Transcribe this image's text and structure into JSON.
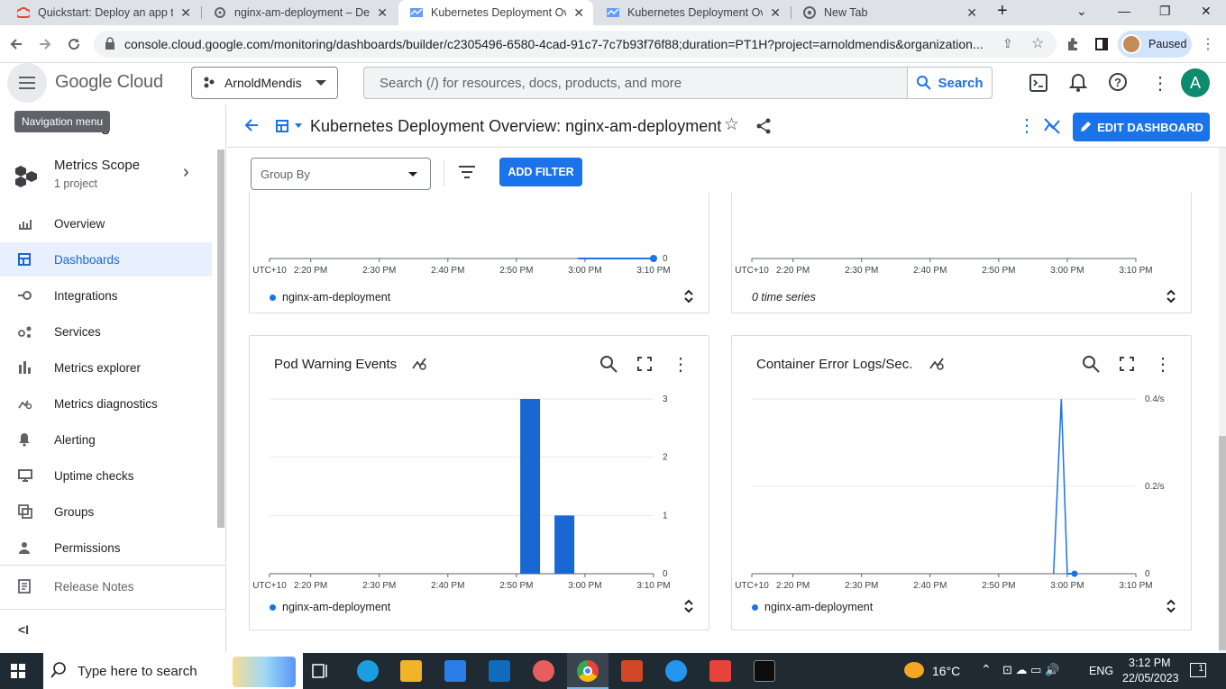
{
  "browser": {
    "tabs": [
      {
        "title": "Quickstart: Deploy an app to",
        "icon": "google-cloud-icon",
        "active": false
      },
      {
        "title": "nginx-am-deployment – Dep",
        "icon": "gear-icon",
        "active": false
      },
      {
        "title": "Kubernetes Deployment Ove",
        "icon": "monitoring-icon",
        "active": true
      },
      {
        "title": "Kubernetes Deployment Ove",
        "icon": "monitoring-icon",
        "active": false
      },
      {
        "title": "New Tab",
        "icon": "chrome-icon",
        "active": false
      }
    ],
    "url": "console.cloud.google.com/monitoring/dashboards/builder/c2305496-6580-4cad-91c7-7c7b93f76f88;duration=PT1H?project=arnoldmendis&organization...",
    "profile_status": "Paused"
  },
  "header": {
    "logo": "Google Cloud",
    "project": "ArnoldMendis",
    "search_placeholder": "Search (/) for resources, docs, products, and more",
    "search_button": "Search",
    "avatar_letter": "A"
  },
  "sidebar": {
    "tooltip": "Navigation menu",
    "section_title_fragment": "ing",
    "scope": {
      "title": "Metrics Scope",
      "subtitle": "1 project"
    },
    "items": [
      {
        "label": "Overview",
        "icon": "overview-icon",
        "active": false
      },
      {
        "label": "Dashboards",
        "icon": "dashboard-icon",
        "active": true
      },
      {
        "label": "Integrations",
        "icon": "integrations-icon",
        "active": false
      },
      {
        "label": "Services",
        "icon": "services-icon",
        "active": false
      },
      {
        "label": "Metrics explorer",
        "icon": "bar-chart-icon",
        "active": false
      },
      {
        "label": "Metrics diagnostics",
        "icon": "diagnostics-icon",
        "active": false
      },
      {
        "label": "Alerting",
        "icon": "bell-icon",
        "active": false
      },
      {
        "label": "Uptime checks",
        "icon": "monitor-icon",
        "active": false
      },
      {
        "label": "Groups",
        "icon": "groups-icon",
        "active": false
      },
      {
        "label": "Permissions",
        "icon": "person-icon",
        "active": false
      }
    ],
    "release_notes": "Release Notes"
  },
  "dashboard": {
    "title": "Kubernetes Deployment Overview: nginx-am-deployment",
    "edit_button": "EDIT DASHBOARD",
    "group_by": "Group By",
    "add_filter": "ADD FILTER"
  },
  "x_ticks": [
    "UTC+10",
    "2:20 PM",
    "2:30 PM",
    "2:40 PM",
    "2:50 PM",
    "3:00 PM",
    "3:10 PM"
  ],
  "charts": [
    {
      "id": "top-left",
      "legend": "nginx-am-deployment",
      "y_label": "0"
    },
    {
      "id": "top-right",
      "legend": "0 time series"
    },
    {
      "id": "pod-warning",
      "title": "Pod Warning Events",
      "legend": "nginx-am-deployment",
      "y_ticks": [
        "3",
        "2",
        "1",
        "0"
      ]
    },
    {
      "id": "container-error",
      "title": "Container Error Logs/Sec.",
      "legend": "nginx-am-deployment",
      "y_ticks": [
        "0.4/s",
        "0.2/s",
        "0"
      ]
    }
  ],
  "chart_data": [
    {
      "type": "line",
      "series": [
        {
          "name": "nginx-am-deployment",
          "x": [
            "2:59 PM",
            "3:10 PM"
          ],
          "values": [
            0,
            0
          ]
        }
      ],
      "ylabel": ""
    },
    {
      "type": "line",
      "series": [],
      "ylabel": ""
    },
    {
      "type": "bar",
      "title": "Pod Warning Events",
      "categories": [
        "2:52 PM",
        "2:57 PM"
      ],
      "series": [
        {
          "name": "nginx-am-deployment",
          "values": [
            3,
            1
          ]
        }
      ],
      "ylim": [
        0,
        3
      ]
    },
    {
      "type": "line",
      "title": "Container Error Logs/Sec.",
      "series": [
        {
          "name": "nginx-am-deployment",
          "x": [
            "2:58 PM",
            "2:59 PM",
            "3:00 PM"
          ],
          "values": [
            0,
            0.4,
            0
          ]
        }
      ],
      "ylim": [
        0,
        0.4
      ]
    }
  ],
  "taskbar": {
    "search_placeholder": "Type here to search",
    "weather": "16°C",
    "language": "ENG",
    "time": "3:12 PM",
    "date": "22/05/2023",
    "notifications": "1"
  }
}
